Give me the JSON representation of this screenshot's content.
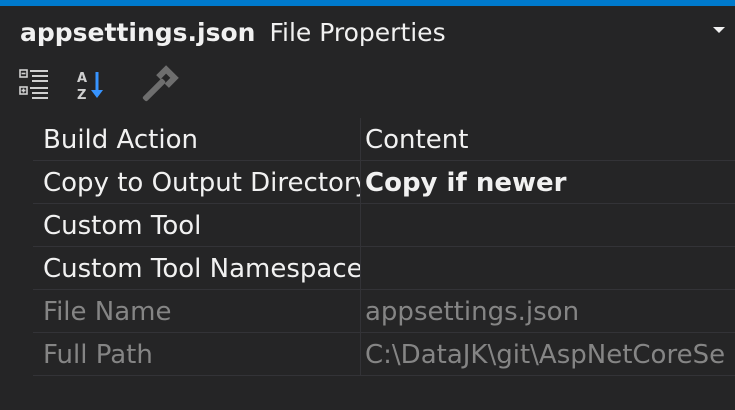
{
  "window": {
    "file_name": "appsettings.json",
    "title_suffix": "File Properties",
    "accent_color": "#007acc"
  },
  "toolbar": {
    "buttons": [
      {
        "icon": "categorized-icon",
        "label": "Categorized"
      },
      {
        "icon": "alphabetical-icon",
        "label": "Alphabetical"
      },
      {
        "icon": "property-pages-icon",
        "label": "Property Pages"
      }
    ]
  },
  "properties": [
    {
      "name": "Build Action",
      "value": "Content",
      "enabled": true,
      "bold": false
    },
    {
      "name": "Copy to Output Directory",
      "value": "Copy if newer",
      "enabled": true,
      "bold": true
    },
    {
      "name": "Custom Tool",
      "value": "",
      "enabled": true,
      "bold": false
    },
    {
      "name": "Custom Tool Namespace",
      "value": "",
      "enabled": true,
      "bold": false
    },
    {
      "name": "File Name",
      "value": "appsettings.json",
      "enabled": false,
      "bold": false
    },
    {
      "name": "Full Path",
      "value": "C:\\DataJK\\git\\AspNetCoreSe",
      "enabled": false,
      "bold": false
    }
  ]
}
